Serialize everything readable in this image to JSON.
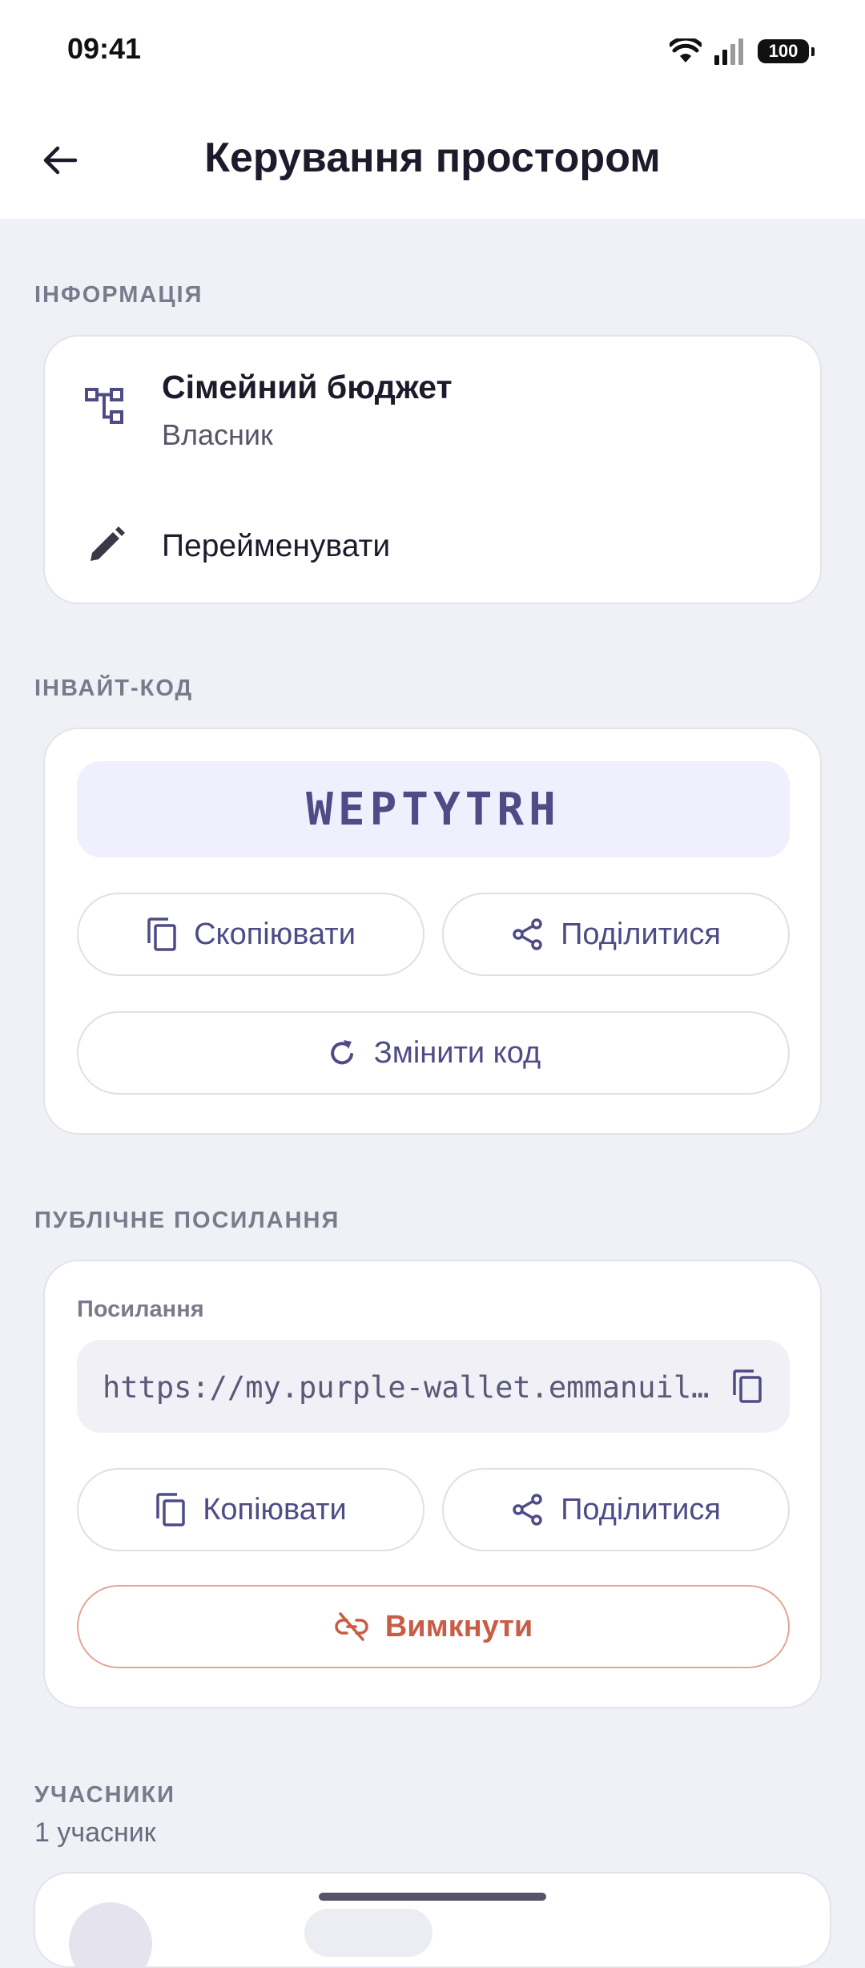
{
  "status_bar": {
    "time": "09:41",
    "battery": "100"
  },
  "app_bar": {
    "title": "Керування простором"
  },
  "info_section": {
    "label": "ІНФОРМАЦІЯ",
    "space_name": "Сімейний бюджет",
    "role": "Власник",
    "rename_label": "Перейменувати"
  },
  "invite_section": {
    "label": "ІНВАЙТ-КОД",
    "code": "WEPTYTRH",
    "copy_label": "Скопіювати",
    "share_label": "Поділитися",
    "regenerate_label": "Змінити код"
  },
  "public_link_section": {
    "label": "ПУБЛІЧНЕ ПОСИЛАННЯ",
    "field_label": "Посилання",
    "url": "https://my.purple-wallet.emmanuil…",
    "copy_label": "Копіювати",
    "share_label": "Поділитися",
    "disable_label": "Вимкнути"
  },
  "members_section": {
    "label": "УЧАСНИКИ",
    "count": "1 учасник"
  },
  "colors": {
    "accent": "#4e4b86",
    "danger": "#c95c45",
    "background": "#f0f1f6",
    "invite_box": "#efeffd"
  }
}
